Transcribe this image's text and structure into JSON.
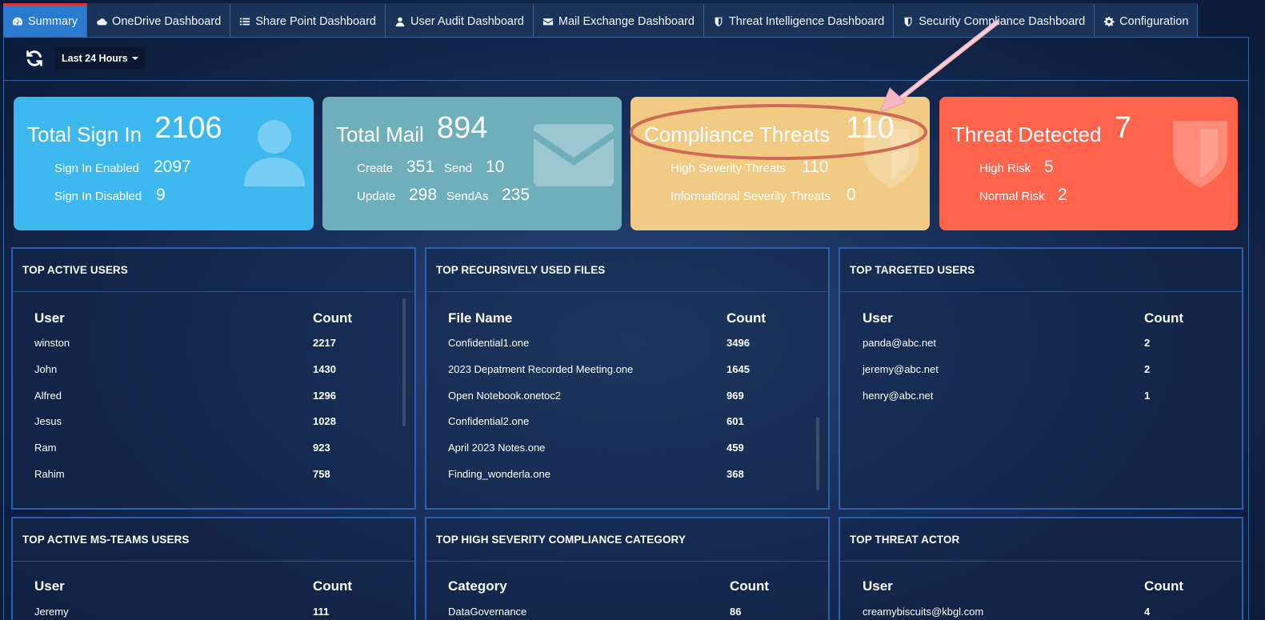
{
  "nav": {
    "tabs": [
      {
        "label": "Summary",
        "icon": "dashboard-icon",
        "active": true
      },
      {
        "label": "OneDrive Dashboard",
        "icon": "cloud-icon"
      },
      {
        "label": "Share Point Dashboard",
        "icon": "list-icon"
      },
      {
        "label": "User Audit Dashboard",
        "icon": "user-icon"
      },
      {
        "label": "Mail Exchange Dashboard",
        "icon": "envelope-icon"
      },
      {
        "label": "Threat Intelligence Dashboard",
        "icon": "shield-icon"
      },
      {
        "label": "Security Compliance Dashboard",
        "icon": "shield-icon"
      },
      {
        "label": "Configuration",
        "icon": "gear-icon"
      }
    ]
  },
  "toolbar": {
    "refresh_icon": "refresh-icon",
    "time_range": "Last 24 Hours"
  },
  "cards": {
    "signin": {
      "title": "Total Sign In",
      "total": "2106",
      "enabled_label": "Sign In Enabled",
      "enabled_value": "2097",
      "disabled_label": "Sign In Disabled",
      "disabled_value": "9",
      "color": "#3db8ef"
    },
    "mail": {
      "title": "Total Mail",
      "total": "894",
      "create_label": "Create",
      "create_value": "351",
      "send_label": "Send",
      "send_value": "10",
      "update_label": "Update",
      "update_value": "298",
      "sendas_label": "SendAs",
      "sendas_value": "235",
      "color": "#6fafbc"
    },
    "compliance": {
      "title": "Compliance Threats",
      "total": "110",
      "high_label": "High Severity Threats",
      "high_value": "110",
      "info_label": "Informational Severity Threats",
      "info_value": "0",
      "color": "#f1cb84"
    },
    "threat": {
      "title": "Threat Detected",
      "total": "7",
      "high_label": "High Risk",
      "high_value": "5",
      "normal_label": "Normal Risk",
      "normal_value": "2",
      "color": "#fd644b"
    }
  },
  "panels": {
    "top_active_users": {
      "title": "TOP ACTIVE USERS",
      "columns": [
        "User",
        "Count"
      ],
      "rows": [
        [
          "winston",
          "2217"
        ],
        [
          "John",
          "1430"
        ],
        [
          "Alfred",
          "1296"
        ],
        [
          "Jesus",
          "1028"
        ],
        [
          "Ram",
          "923"
        ],
        [
          "Rahim",
          "758"
        ]
      ]
    },
    "top_files": {
      "title": "TOP RECURSIVELY USED FILES",
      "columns": [
        "File Name",
        "Count"
      ],
      "rows": [
        [
          "Confidential1.one",
          "3496"
        ],
        [
          "2023 Depatment Recorded Meeting.one",
          "1645"
        ],
        [
          "Open Notebook.onetoc2",
          "969"
        ],
        [
          "Confidential2.one",
          "601"
        ],
        [
          "April 2023 Notes.one",
          "459"
        ],
        [
          "Finding_wonderla.one",
          "368"
        ]
      ]
    },
    "top_targeted_users": {
      "title": "TOP TARGETED USERS",
      "columns": [
        "User",
        "Count"
      ],
      "rows": [
        [
          "panda@abc.net",
          "2"
        ],
        [
          "jeremy@abc.net",
          "2"
        ],
        [
          "henry@abc.net",
          "1"
        ]
      ]
    },
    "top_teams_users": {
      "title": "TOP ACTIVE MS-TEAMS USERS",
      "columns": [
        "User",
        "Count"
      ],
      "rows": [
        [
          "Jeremy",
          "111"
        ]
      ]
    },
    "top_compliance_category": {
      "title": "TOP HIGH SEVERITY COMPLIANCE CATEGORY",
      "columns": [
        "Category",
        "Count"
      ],
      "rows": [
        [
          "DataGovernance",
          "86"
        ]
      ]
    },
    "top_threat_actor": {
      "title": "TOP THREAT ACTOR",
      "columns": [
        "User",
        "Count"
      ],
      "rows": [
        [
          "creamybiscuits@kbgl.com",
          "4"
        ]
      ]
    }
  }
}
